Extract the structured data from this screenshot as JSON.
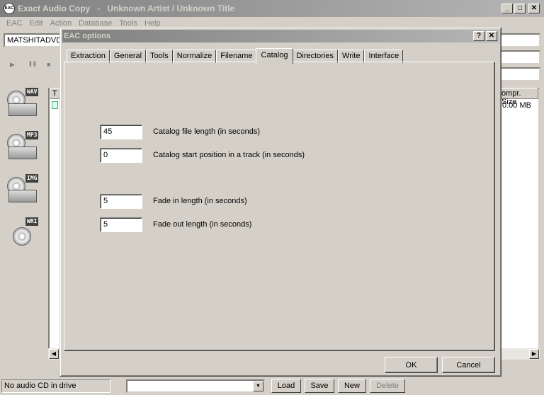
{
  "app": {
    "icon_text": "EAC",
    "title": "Exact Audio Copy   -   Unknown Artist / Unknown Title",
    "window_buttons": {
      "minimize": "_",
      "maximize": "□",
      "close": "✕"
    }
  },
  "menu": [
    "EAC",
    "Edit",
    "Action",
    "Database",
    "Tools",
    "Help"
  ],
  "drive": {
    "value": "MATSHITADVD"
  },
  "toolbar": {
    "play": "▶",
    "pause": "❚❚",
    "stop": "■"
  },
  "side_buttons": [
    "WAV",
    "MP3",
    "IMG",
    "WRI"
  ],
  "track_list": {
    "col_first": "T",
    "col_compr_size": "ompr. Size",
    "row_size": "0.00 MB"
  },
  "statusbar": {
    "status_text": "No audio CD in drive",
    "combo_arrow": "▼",
    "buttons": {
      "load": "Load",
      "save": "Save",
      "new": "New",
      "delete": "Delete"
    }
  },
  "dialog": {
    "title": "EAC options",
    "help_btn": "?",
    "close_btn": "✕",
    "tabs": [
      "Extraction",
      "General",
      "Tools",
      "Normalize",
      "Filename",
      "Catalog",
      "Directories",
      "Write",
      "Interface"
    ],
    "active_tab": "Catalog",
    "fields": [
      {
        "value": "45",
        "label": "Catalog file length (in seconds)"
      },
      {
        "value": "0",
        "label": "Catalog start position in a track (in seconds)"
      },
      {
        "value": "5",
        "label": "Fade in length (in seconds)"
      },
      {
        "value": "5",
        "label": "Fade out length (in seconds)"
      }
    ],
    "ok_label": "OK",
    "cancel_label": "Cancel"
  },
  "scroll": {
    "left": "◀",
    "right": "▶"
  }
}
